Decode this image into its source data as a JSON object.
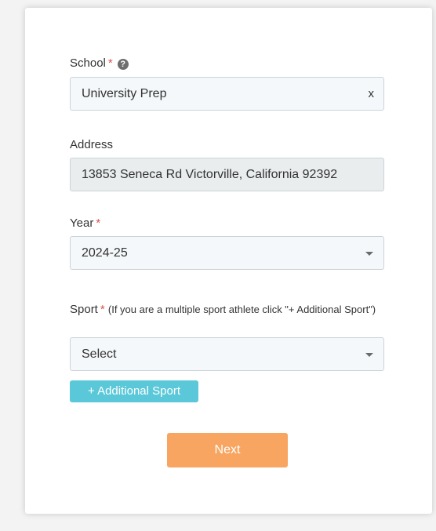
{
  "school": {
    "label": "School",
    "required_mark": "*",
    "help_glyph": "?",
    "value": "University Prep",
    "clear_label": "x"
  },
  "address": {
    "label": "Address",
    "value": "13853 Seneca Rd Victorville, California 92392"
  },
  "year": {
    "label": "Year",
    "required_mark": "*",
    "value": "2024-25"
  },
  "sport": {
    "label": "Sport",
    "required_mark": "*",
    "note": "(If you are a multiple sport athlete click \"+ Additional Sport\")",
    "value": "Select"
  },
  "buttons": {
    "additional_sport": "+ Additional Sport",
    "next": "Next"
  },
  "colors": {
    "required": "#d9534f",
    "additional_sport_button": "#5bc8d9",
    "next_button": "#f7a560"
  },
  "icons": {
    "help": "question-circle-icon",
    "dropdown": "caret-down-icon"
  }
}
